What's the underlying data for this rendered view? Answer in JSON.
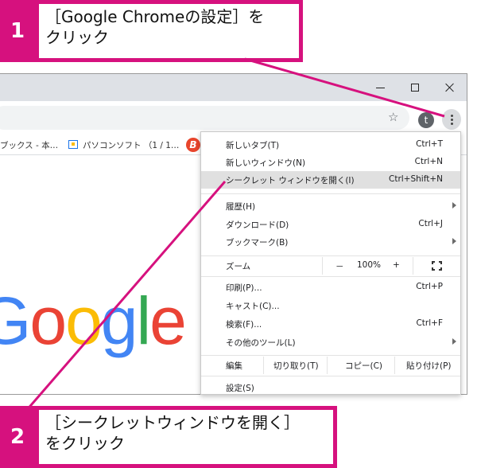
{
  "callout1": {
    "number": "1",
    "line1": "［Google Chromeの設定］を",
    "line2": "クリック"
  },
  "callout2": {
    "number": "2",
    "line1": "［シークレットウィンドウを開く］",
    "line2": "をクリック"
  },
  "profile_initial": "t",
  "bookmarks": [
    "ブックス - 本…",
    "パソコンソフト （1 / 1…",
    "B"
  ],
  "logo_text": "Google",
  "menu": {
    "items1": [
      {
        "label": "新しいタブ(T)",
        "shortcut": "Ctrl+T"
      },
      {
        "label": "新しいウィンドウ(N)",
        "shortcut": "Ctrl+N"
      },
      {
        "label": "シークレット ウィンドウを開く(I)",
        "shortcut": "Ctrl+Shift+N"
      }
    ],
    "items2": [
      {
        "label": "履歴(H)"
      },
      {
        "label": "ダウンロード(D)",
        "shortcut": "Ctrl+J"
      },
      {
        "label": "ブックマーク(B)"
      }
    ],
    "zoom": {
      "label": "ズーム",
      "minus": "－",
      "value": "100%",
      "plus": "+"
    },
    "items3": [
      {
        "label": "印刷(P)...",
        "shortcut": "Ctrl+P"
      },
      {
        "label": "キャスト(C)..."
      },
      {
        "label": "検索(F)...",
        "shortcut": "Ctrl+F"
      },
      {
        "label": "その他のツール(L)"
      }
    ],
    "edit": {
      "label": "編集",
      "cut": "切り取り(T)",
      "copy": "コピー(C)",
      "paste": "貼り付け(P)"
    },
    "settings": "設定(S)"
  },
  "colors": {
    "accent": "#d6117e",
    "highlight": "#e0e0e0"
  }
}
